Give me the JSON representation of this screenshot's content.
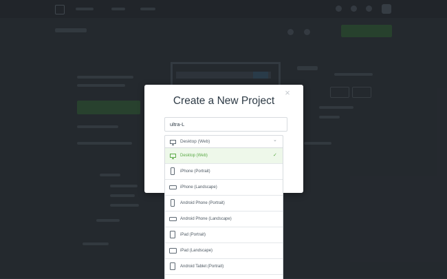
{
  "modal": {
    "title": "Create a New Project",
    "close_icon": "×",
    "project_name": "ultra-L",
    "device_select": {
      "selected_label": "Desktop (Web)",
      "chevron": "⌄"
    },
    "check_icon": "✓",
    "options": [
      {
        "label": "Desktop (Web)",
        "icon": "desktop-icon",
        "selected": true
      },
      {
        "label": "iPhone (Portrait)",
        "icon": "phone-portrait-icon",
        "selected": false
      },
      {
        "label": "iPhone (Landscape)",
        "icon": "phone-landscape-icon",
        "selected": false
      },
      {
        "label": "Android Phone (Portrait)",
        "icon": "phone-portrait-icon",
        "selected": false
      },
      {
        "label": "Android Phone (Landscape)",
        "icon": "phone-landscape-icon",
        "selected": false
      },
      {
        "label": "iPad (Portrait)",
        "icon": "tablet-portrait-icon",
        "selected": false
      },
      {
        "label": "iPad (Landscape)",
        "icon": "tablet-landscape-icon",
        "selected": false
      },
      {
        "label": "Android Tablet (Portrait)",
        "icon": "tablet-portrait-icon",
        "selected": false
      }
    ]
  },
  "colors": {
    "accent_green": "#5aa945",
    "selected_row_bg": "#eef8ea",
    "backdrop": "#2a2f35",
    "title_text": "#2d3a45"
  }
}
